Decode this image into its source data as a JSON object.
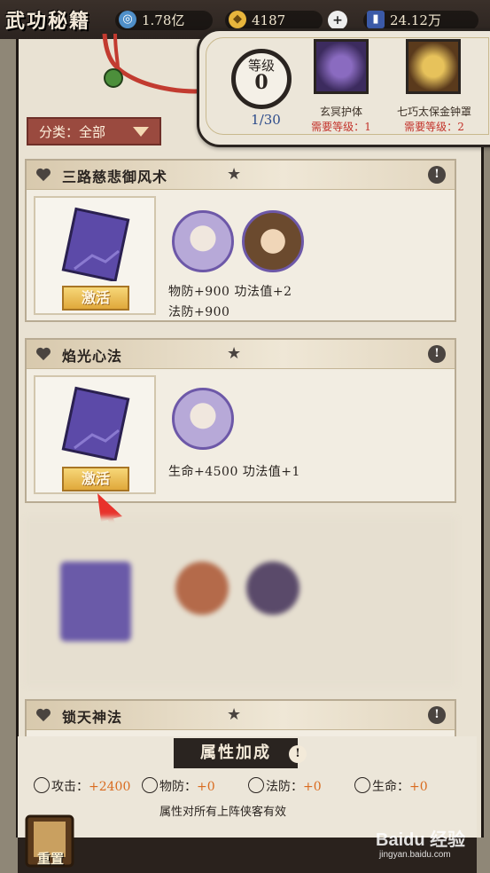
{
  "header": {
    "title": "武功秘籍",
    "resources": [
      {
        "icon": "jade-icon",
        "value": "1.78亿"
      },
      {
        "icon": "gold-ingot-icon",
        "value": "4187"
      },
      {
        "icon": "token-icon",
        "value": "24.12万"
      }
    ]
  },
  "level_panel": {
    "label": "等级",
    "value": "0",
    "progress": "1/30",
    "skills": [
      {
        "name": "玄冥护体",
        "req_label": "需要等级：",
        "req_value": "1"
      },
      {
        "name": "七巧太保金钟罩",
        "req_label": "需要等级：",
        "req_value": "2"
      }
    ]
  },
  "category": {
    "label": "分类：全部"
  },
  "cards": [
    {
      "title": "三路慈悲御风术",
      "button": "激活",
      "stats_line1": "物防+900 功法值+2",
      "stats_line2": "法防+900"
    },
    {
      "title": "焰光心法",
      "button": "激活",
      "stats_line1": "生命+4500 功法值+1",
      "stats_line2": ""
    },
    {
      "title": "锁天神法"
    }
  ],
  "attributes": {
    "title": "属性加成",
    "items": [
      {
        "label": "攻击：",
        "value": "+2400"
      },
      {
        "label": "物防：",
        "value": "+0"
      },
      {
        "label": "法防：",
        "value": "+0"
      },
      {
        "label": "生命：",
        "value": "+0"
      }
    ],
    "note": "属性对所有上阵侠客有效"
  },
  "reset_label": "重置",
  "watermark": {
    "brand": "Baidu 经验",
    "url": "jingyan.baidu.com"
  },
  "colors": {
    "accent_red": "#c3332b",
    "bonus_orange": "#d96b1f",
    "button_gold": "#e0a83b"
  }
}
